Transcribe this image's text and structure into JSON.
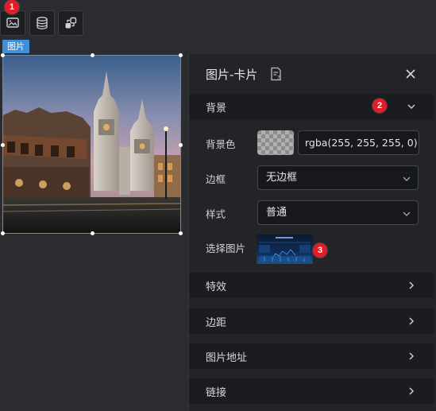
{
  "toolbar": {
    "buttons": [
      {
        "icon": "image-icon"
      },
      {
        "icon": "database-icon"
      },
      {
        "icon": "link-icon"
      }
    ]
  },
  "markers": {
    "m1": "1",
    "m2": "2",
    "m3": "3"
  },
  "component_tag": "图片",
  "panel": {
    "title": "图片-卡片",
    "help_icon": "document-help-icon",
    "close_icon": "close-icon",
    "sections": {
      "background": "背景",
      "effects": "特效",
      "margin": "边距",
      "image_url": "图片地址",
      "link": "链接"
    },
    "fields": {
      "bg_color_label": "背景色",
      "bg_color_value": "rgba(255, 255, 255, 0)",
      "border_label": "边框",
      "border_value": "无边框",
      "style_label": "样式",
      "style_value": "普通",
      "select_image_label": "选择图片"
    }
  },
  "colors": {
    "accent": "#3f8fdb",
    "marker": "#e11d27",
    "panel_bg": "#232428",
    "section_bg": "#1b1c20"
  }
}
